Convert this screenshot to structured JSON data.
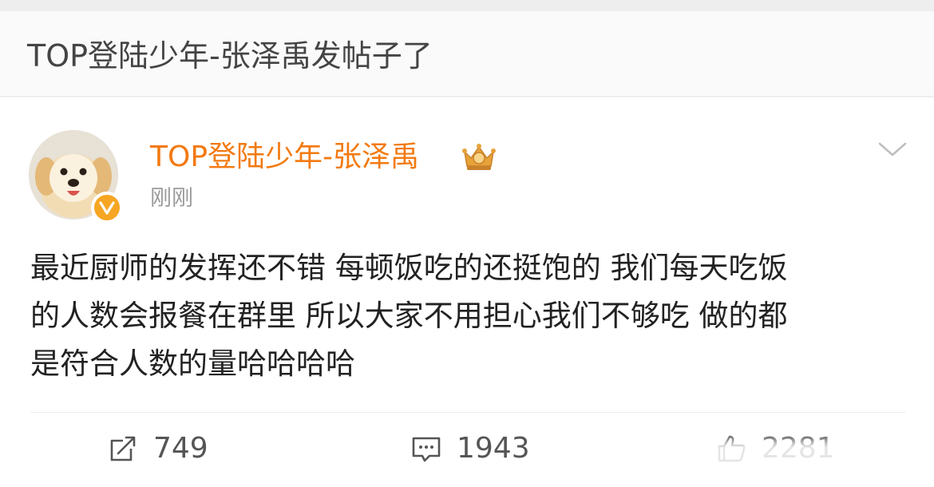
{
  "notice": {
    "text": "TOP登陆少年-张泽禹发帖子了"
  },
  "post": {
    "author": "TOP登陆少年-张泽禹",
    "time": "刚刚",
    "lines": [
      "最近厨师的发挥还不错 每顿饭吃的还挺饱的 我们每天吃饭",
      "的人数会报餐在群里 所以大家不用担心我们不够吃 做的都",
      "是符合人数的量哈哈哈哈"
    ],
    "verified_badge_icon": "verified-v-icon",
    "member_badge_icon": "crown-badge-icon",
    "menu_icon": "chevron-down-icon"
  },
  "actions": {
    "repost": {
      "icon": "repost-icon",
      "count": "749"
    },
    "comment": {
      "icon": "comment-icon",
      "count": "1943"
    },
    "like": {
      "icon": "thumbs-up-icon",
      "count": "2281"
    }
  },
  "colors": {
    "author": "#f27a11",
    "badge": "#f6a623",
    "text": "#222222",
    "muted": "#9a9a9a"
  }
}
